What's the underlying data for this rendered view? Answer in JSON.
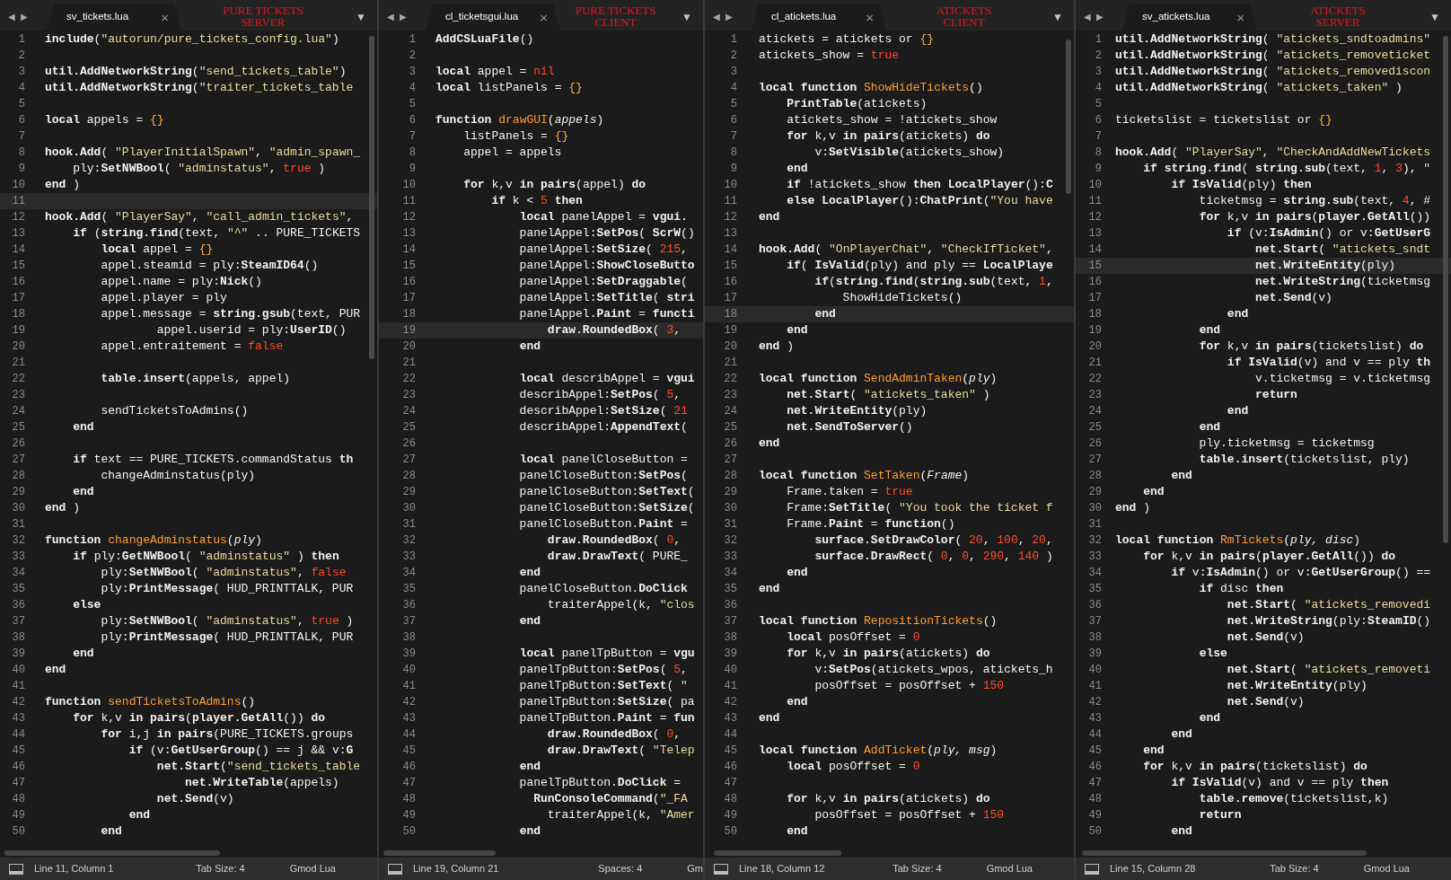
{
  "panes": [
    {
      "nav_back": "◀",
      "nav_forward": "▶",
      "file": "sv_tickets.lua",
      "close": "×",
      "label": [
        "PURE TICKETS",
        "SERVER"
      ],
      "menu": "▼",
      "lines": [
        {
          "n": "1",
          "code": "**include**(\"autorun/pure_tickets_config.lua\")",
          "active": false
        },
        {
          "n": "2",
          "active": false
        },
        {
          "n": "3",
          "code": "**util.AddNetworkString**(\"send_tickets_table\")",
          "active": false
        },
        {
          "n": "4",
          "code": "**util.AddNetworkString**(\"traiter_tickets_table",
          "active": false
        },
        {
          "n": "5",
          "active": false
        },
        {
          "n": "6",
          "code": "**local** appels = {}",
          "active": false
        },
        {
          "n": "7",
          "active": false
        },
        {
          "n": "8",
          "code": "**hook.Add**( \"PlayerInitialSpawn\", \"admin_spawn_",
          "active": false
        },
        {
          "n": "9",
          "code": "    ply:**SetNWBool**( \"adminstatus\", true )",
          "active": false
        },
        {
          "n": "10",
          "code": "**end** )",
          "active": false
        },
        {
          "n": "11",
          "active": true
        },
        {
          "n": "12",
          "code": "**hook.Add**( \"PlayerSay\", \"call_admin_tickets\",",
          "active": false
        },
        {
          "n": "13",
          "code": "    **if** (**string.find**(text, \"^\" .. PURE_TICKETS",
          "active": false
        },
        {
          "n": "14",
          "code": "        **local** appel = {}",
          "active": false
        },
        {
          "n": "15",
          "code": "        appel.steamid = ply:**SteamID64**()",
          "active": false
        },
        {
          "n": "16",
          "code": "        appel.name = ply:**Nick**()",
          "active": false
        },
        {
          "n": "17",
          "code": "        appel.player = ply",
          "active": false
        },
        {
          "n": "18",
          "code": "        appel.message = **string.gsub**(text, PUR",
          "active": false
        },
        {
          "n": "19",
          "code": "                appel.userid = ply:**UserID**()",
          "active": false
        },
        {
          "n": "20",
          "code": "        appel.entraitement = false",
          "active": false
        },
        {
          "n": "21",
          "active": false
        },
        {
          "n": "22",
          "code": "        **table.insert**(appels, appel)",
          "active": false
        },
        {
          "n": "23",
          "active": false
        },
        {
          "n": "24",
          "code": "        sendTicketsToAdmins()",
          "active": false
        },
        {
          "n": "25",
          "code": "    **end**",
          "active": false
        },
        {
          "n": "26",
          "active": false
        },
        {
          "n": "27",
          "code": "    **if** text == PURE_TICKETS.commandStatus **th**",
          "active": false
        },
        {
          "n": "28",
          "code": "        changeAdminstatus(ply)",
          "active": false
        },
        {
          "n": "29",
          "code": "    **end**",
          "active": false
        },
        {
          "n": "30",
          "code": "**end** )",
          "active": false
        },
        {
          "n": "31",
          "active": false
        },
        {
          "n": "32",
          "code": "**function** changeAdminstatus(*ply*)",
          "active": false
        },
        {
          "n": "33",
          "code": "    **if** ply:**GetNWBool**( \"adminstatus\" ) **then**",
          "active": false
        },
        {
          "n": "34",
          "code": "        ply:**SetNWBool**( \"adminstatus\", false",
          "active": false
        },
        {
          "n": "35",
          "code": "        ply:**PrintMessage**( HUD_PRINTTALK, PUR",
          "active": false
        },
        {
          "n": "36",
          "code": "    **else**",
          "active": false
        },
        {
          "n": "37",
          "code": "        ply:**SetNWBool**( \"adminstatus\", true )",
          "active": false
        },
        {
          "n": "38",
          "code": "        ply:**PrintMessage**( HUD_PRINTTALK, PUR",
          "active": false
        },
        {
          "n": "39",
          "code": "    **end**",
          "active": false
        },
        {
          "n": "40",
          "code": "**end**",
          "active": false
        },
        {
          "n": "41",
          "active": false
        },
        {
          "n": "42",
          "code": "**function** sendTicketsToAdmins()",
          "active": false
        },
        {
          "n": "43",
          "code": "    **for** k,v **in** **pairs**(**player.GetAll**()) **do**",
          "active": false
        },
        {
          "n": "44",
          "code": "        **for** i,j **in** **pairs**(PURE_TICKETS.groups",
          "active": false
        },
        {
          "n": "45",
          "code": "            **if** (v:**GetUserGroup**() == j && v:**G**",
          "active": false
        },
        {
          "n": "46",
          "code": "                **net.Start**(\"send_tickets_table",
          "active": false
        },
        {
          "n": "47",
          "code": "                    **net.WriteTable**(appels)",
          "active": false
        },
        {
          "n": "48",
          "code": "                **net.Send**(v)",
          "active": false
        },
        {
          "n": "49",
          "code": "            **end**",
          "active": false
        },
        {
          "n": "50",
          "code": "        **end**",
          "active": false
        }
      ],
      "status": {
        "position": "Line 11, Column 1",
        "indent": "Tab Size: 4",
        "syntax": "Gmod Lua"
      }
    },
    {
      "nav_back": "◀",
      "nav_forward": "▶",
      "file": "cl_ticketsgui.lua",
      "close": "×",
      "label": [
        "PURE TICKETS",
        "CLIENT"
      ],
      "menu": "▼",
      "lines": [
        {
          "n": "1",
          "code": "**AddCSLuaFile**()",
          "active": false
        },
        {
          "n": "2",
          "active": false
        },
        {
          "n": "3",
          "code": "**local** appel = nil",
          "active": false
        },
        {
          "n": "4",
          "code": "**local** listPanels = {}",
          "active": false
        },
        {
          "n": "5",
          "active": false
        },
        {
          "n": "6",
          "code": "**function** drawGUI(*appels*)",
          "active": false
        },
        {
          "n": "7",
          "code": "    listPanels = {}",
          "active": false
        },
        {
          "n": "8",
          "code": "    appel = appels",
          "active": false
        },
        {
          "n": "9",
          "active": false
        },
        {
          "n": "10",
          "code": "    **for** k,v **in** **pairs**(appel) **do**",
          "active": false
        },
        {
          "n": "11",
          "code": "        **if** k < 5 **then**",
          "active": false
        },
        {
          "n": "12",
          "code": "            **local** panelAppel = **vgui.**",
          "active": false
        },
        {
          "n": "13",
          "code": "            panelAppel:**SetPos**( **ScrW**()",
          "active": false
        },
        {
          "n": "14",
          "code": "            panelAppel:**SetSize**( 215,",
          "active": false
        },
        {
          "n": "15",
          "code": "            panelAppel:**ShowCloseButto**",
          "active": false
        },
        {
          "n": "16",
          "code": "            panelAppel:**SetDraggable**(",
          "active": false
        },
        {
          "n": "17",
          "code": "            panelAppel:**SetTitle**( **stri**",
          "active": false
        },
        {
          "n": "18",
          "code": "            panelAppel.**Paint** = **functi**",
          "active": false
        },
        {
          "n": "19",
          "code": "                **draw.RoundedBox**( 3,",
          "active": true
        },
        {
          "n": "20",
          "code": "            **end**",
          "active": false
        },
        {
          "n": "21",
          "active": false
        },
        {
          "n": "22",
          "code": "            **local** describAppel = **vgui**",
          "active": false
        },
        {
          "n": "23",
          "code": "            describAppel:**SetPos**( 5,",
          "active": false
        },
        {
          "n": "24",
          "code": "            describAppel:**SetSize**( 21",
          "active": false
        },
        {
          "n": "25",
          "code": "            describAppel:**AppendText**(",
          "active": false
        },
        {
          "n": "26",
          "active": false
        },
        {
          "n": "27",
          "code": "            **local** panelCloseButton =",
          "active": false
        },
        {
          "n": "28",
          "code": "            panelCloseButton:**SetPos**(",
          "active": false
        },
        {
          "n": "29",
          "code": "            panelCloseButton:**SetText**(",
          "active": false
        },
        {
          "n": "30",
          "code": "            panelCloseButton:**SetSize**(",
          "active": false
        },
        {
          "n": "31",
          "code": "            panelCloseButton.**Paint** =",
          "active": false
        },
        {
          "n": "32",
          "code": "                **draw.RoundedBox**( 0,",
          "active": false
        },
        {
          "n": "33",
          "code": "                **draw.DrawText**( PURE_",
          "active": false
        },
        {
          "n": "34",
          "code": "            **end**",
          "active": false
        },
        {
          "n": "35",
          "code": "            panelCloseButton.**DoClick**",
          "active": false
        },
        {
          "n": "36",
          "code": "                traiterAppel(k, \"clos",
          "active": false
        },
        {
          "n": "37",
          "code": "            **end**",
          "active": false
        },
        {
          "n": "38",
          "active": false
        },
        {
          "n": "39",
          "code": "            **local** panelTpButton = **vgu**",
          "active": false
        },
        {
          "n": "40",
          "code": "            panelTpButton:**SetPos**( 5,",
          "active": false
        },
        {
          "n": "41",
          "code": "            panelTpButton:**SetText**( \"",
          "active": false
        },
        {
          "n": "42",
          "code": "            panelTpButton:**SetSize**( pa",
          "active": false
        },
        {
          "n": "43",
          "code": "            panelTpButton.**Paint** = **fun**",
          "active": false
        },
        {
          "n": "44",
          "code": "                **draw.RoundedBox**( 0,",
          "active": false
        },
        {
          "n": "45",
          "code": "                **draw.DrawText**( \"Telep",
          "active": false
        },
        {
          "n": "46",
          "code": "            **end**",
          "active": false
        },
        {
          "n": "47",
          "code": "            panelTpButton.**DoClick** =",
          "active": false
        },
        {
          "n": "48",
          "code": "              **RunConsoleCommand**(\"_FA",
          "active": false
        },
        {
          "n": "49",
          "code": "                traiterAppel(k, \"Amer",
          "active": false
        },
        {
          "n": "50",
          "code": "            **end**",
          "active": false
        }
      ],
      "status": {
        "position": "Line 19, Column 21",
        "indent": "Spaces: 4",
        "syntax": "Gm"
      }
    },
    {
      "nav_back": "◀",
      "nav_forward": "▶",
      "file": "cl_atickets.lua",
      "close": "×",
      "label": [
        "ATICKETS",
        "CLIENT"
      ],
      "menu": "▼",
      "lines": [
        {
          "n": "1",
          "code": "atickets = atickets or {}",
          "active": false
        },
        {
          "n": "2",
          "code": "atickets_show = true",
          "active": false
        },
        {
          "n": "3",
          "active": false
        },
        {
          "n": "4",
          "code": "**local** **function** ShowHideTickets()",
          "active": false
        },
        {
          "n": "5",
          "code": "    **PrintTable**(atickets)",
          "active": false
        },
        {
          "n": "6",
          "code": "    atickets_show = !atickets_show",
          "active": false
        },
        {
          "n": "7",
          "code": "    **for** k,v **in** **pairs**(atickets) **do**",
          "active": false
        },
        {
          "n": "8",
          "code": "        v:**SetVisible**(atickets_show)",
          "active": false
        },
        {
          "n": "9",
          "code": "    **end**",
          "active": false
        },
        {
          "n": "10",
          "code": "    **if** !atickets_show **then** **LocalPlayer**():**C**",
          "active": false
        },
        {
          "n": "11",
          "code": "    **else** **LocalPlayer**():**ChatPrint**(\"You have",
          "active": false
        },
        {
          "n": "12",
          "code": "**end**",
          "active": false
        },
        {
          "n": "13",
          "active": false
        },
        {
          "n": "14",
          "code": "**hook.Add**( \"OnPlayerChat\", \"CheckIfTicket\",",
          "active": false
        },
        {
          "n": "15",
          "code": "    **if**( **IsValid**(ply) and ply == **LocalPlaye**",
          "active": false
        },
        {
          "n": "16",
          "code": "        **if**(**string.find**(**string.sub**(text, 1,",
          "active": false
        },
        {
          "n": "17",
          "code": "            ShowHideTickets()",
          "active": false
        },
        {
          "n": "18",
          "code": "        **end**",
          "active": true
        },
        {
          "n": "19",
          "code": "    **end**",
          "active": false
        },
        {
          "n": "20",
          "code": "**end** )",
          "active": false
        },
        {
          "n": "21",
          "active": false
        },
        {
          "n": "22",
          "code": "**local** **function** SendAdminTaken(*ply*)",
          "active": false
        },
        {
          "n": "23",
          "code": "    **net.Start**( \"atickets_taken\" )",
          "active": false
        },
        {
          "n": "24",
          "code": "    **net.WriteEntity**(ply)",
          "active": false
        },
        {
          "n": "25",
          "code": "    **net.SendToServer**()",
          "active": false
        },
        {
          "n": "26",
          "code": "**end**",
          "active": false
        },
        {
          "n": "27",
          "active": false
        },
        {
          "n": "28",
          "code": "**local** **function** SetTaken(*Frame*)",
          "active": false
        },
        {
          "n": "29",
          "code": "    Frame.taken = true",
          "active": false
        },
        {
          "n": "30",
          "code": "    Frame:**SetTitle**( \"You took the ticket f",
          "active": false
        },
        {
          "n": "31",
          "code": "    Frame.**Paint** = **function**()",
          "active": false
        },
        {
          "n": "32",
          "code": "        **surface.SetDrawColor**( 20, 100, 20,",
          "active": false
        },
        {
          "n": "33",
          "code": "        **surface.DrawRect**( 0, 0, 290, 140 )",
          "active": false
        },
        {
          "n": "34",
          "code": "    **end**",
          "active": false
        },
        {
          "n": "35",
          "code": "**end**",
          "active": false
        },
        {
          "n": "36",
          "active": false
        },
        {
          "n": "37",
          "code": "**local** **function** RepositionTickets()",
          "active": false
        },
        {
          "n": "38",
          "code": "    **local** posOffset = 0",
          "active": false
        },
        {
          "n": "39",
          "code": "    **for** k,v **in** **pairs**(atickets) **do**",
          "active": false
        },
        {
          "n": "40",
          "code": "        v:**SetPos**(atickets_wpos, atickets_h",
          "active": false
        },
        {
          "n": "41",
          "code": "        posOffset = posOffset + 150",
          "active": false
        },
        {
          "n": "42",
          "code": "    **end**",
          "active": false
        },
        {
          "n": "43",
          "code": "**end**",
          "active": false
        },
        {
          "n": "44",
          "active": false
        },
        {
          "n": "45",
          "code": "**local** **function** AddTicket(*ply, msg*)",
          "active": false
        },
        {
          "n": "46",
          "code": "    **local** posOffset = 0",
          "active": false
        },
        {
          "n": "47",
          "active": false
        },
        {
          "n": "48",
          "code": "    **for** k,v **in** **pairs**(atickets) **do**",
          "active": false
        },
        {
          "n": "49",
          "code": "        posOffset = posOffset + 150",
          "active": false
        },
        {
          "n": "50",
          "code": "    **end**",
          "active": false
        }
      ],
      "status": {
        "position": "Line 18, Column 12",
        "indent": "Tab Size: 4",
        "syntax": "Gmod Lua"
      }
    },
    {
      "nav_back": "◀",
      "nav_forward": "▶",
      "file": "sv_atickets.lua",
      "close": "×",
      "label": [
        "ATICKETS",
        "SERVER"
      ],
      "menu": "▼",
      "lines": [
        {
          "n": "1",
          "code": "**util.AddNetworkString**( \"atickets_sndtoadmins\"",
          "active": false
        },
        {
          "n": "2",
          "code": "**util.AddNetworkString**( \"atickets_removeticket",
          "active": false
        },
        {
          "n": "3",
          "code": "**util.AddNetworkString**( \"atickets_removediscon",
          "active": false
        },
        {
          "n": "4",
          "code": "**util.AddNetworkString**( \"atickets_taken\" )",
          "active": false
        },
        {
          "n": "5",
          "active": false
        },
        {
          "n": "6",
          "code": "ticketslist = ticketslist or {}",
          "active": false
        },
        {
          "n": "7",
          "active": false
        },
        {
          "n": "8",
          "code": "**hook.Add**( \"PlayerSay\", \"CheckAndAddNewTickets",
          "active": false
        },
        {
          "n": "9",
          "code": "    **if** **string.find**( **string.sub**(text, 1, 3), \"",
          "active": false
        },
        {
          "n": "10",
          "code": "        **if** **IsValid**(ply) **then**",
          "active": false
        },
        {
          "n": "11",
          "code": "            ticketmsg = **string.sub**(text, 4, #",
          "active": false
        },
        {
          "n": "12",
          "code": "            **for** k,v **in** **pairs**(**player.GetAll**())",
          "active": false
        },
        {
          "n": "13",
          "code": "                **if** (v:**IsAdmin**() or v:**GetUserG**",
          "active": false
        },
        {
          "n": "14",
          "code": "                    **net.Start**( \"atickets_sndt",
          "active": false
        },
        {
          "n": "15",
          "code": "                    **net.WriteEntity**(ply)",
          "active": true
        },
        {
          "n": "16",
          "code": "                    **net.WriteString**(ticketmsg",
          "active": false
        },
        {
          "n": "17",
          "code": "                    **net.Send**(v)",
          "active": false
        },
        {
          "n": "18",
          "code": "                **end**",
          "active": false
        },
        {
          "n": "19",
          "code": "            **end**",
          "active": false
        },
        {
          "n": "20",
          "code": "            **for** k,v **in** **pairs**(ticketslist) **do**",
          "active": false
        },
        {
          "n": "21",
          "code": "                **if** **IsValid**(v) and v == ply **th**",
          "active": false
        },
        {
          "n": "22",
          "code": "                    v.ticketmsg = v.ticketmsg",
          "active": false
        },
        {
          "n": "23",
          "code": "                    **return**",
          "active": false
        },
        {
          "n": "24",
          "code": "                **end**",
          "active": false
        },
        {
          "n": "25",
          "code": "            **end**",
          "active": false
        },
        {
          "n": "26",
          "code": "            ply.ticketmsg = ticketmsg",
          "active": false
        },
        {
          "n": "27",
          "code": "            **table.insert**(ticketslist, ply)",
          "active": false
        },
        {
          "n": "28",
          "code": "        **end**",
          "active": false
        },
        {
          "n": "29",
          "code": "    **end**",
          "active": false
        },
        {
          "n": "30",
          "code": "**end** )",
          "active": false
        },
        {
          "n": "31",
          "active": false
        },
        {
          "n": "32",
          "code": "**local** **function** RmTickets(*ply, disc*)",
          "active": false
        },
        {
          "n": "33",
          "code": "    **for** k,v **in** **pairs**(**player.GetAll**()) **do**",
          "active": false
        },
        {
          "n": "34",
          "code": "        **if** v:**IsAdmin**() or v:**GetUserGroup**() ==",
          "active": false
        },
        {
          "n": "35",
          "code": "            **if** disc **then**",
          "active": false
        },
        {
          "n": "36",
          "code": "                **net.Start**( \"atickets_removedi",
          "active": false
        },
        {
          "n": "37",
          "code": "                **net.WriteString**(ply:**SteamID**()",
          "active": false
        },
        {
          "n": "38",
          "code": "                **net.Send**(v)",
          "active": false
        },
        {
          "n": "39",
          "code": "            **else**",
          "active": false
        },
        {
          "n": "40",
          "code": "                **net.Start**( \"atickets_removeti",
          "active": false
        },
        {
          "n": "41",
          "code": "                **net.WriteEntity**(ply)",
          "active": false
        },
        {
          "n": "42",
          "code": "                **net.Send**(v)",
          "active": false
        },
        {
          "n": "43",
          "code": "            **end**",
          "active": false
        },
        {
          "n": "44",
          "code": "        **end**",
          "active": false
        },
        {
          "n": "45",
          "code": "    **end**",
          "active": false
        },
        {
          "n": "46",
          "code": "    **for** k,v **in** **pairs**(ticketslist) **do**",
          "active": false
        },
        {
          "n": "47",
          "code": "        **if** **IsValid**(v) and v == ply **then**",
          "active": false
        },
        {
          "n": "48",
          "code": "            **table.remove**(ticketslist,k)",
          "active": false
        },
        {
          "n": "49",
          "code": "            **return**",
          "active": false
        },
        {
          "n": "50",
          "code": "        **end**",
          "active": false
        }
      ],
      "status": {
        "position": "Line 15, Column 28",
        "indent": "Tab Size: 4",
        "syntax": "Gmod Lua"
      }
    }
  ]
}
